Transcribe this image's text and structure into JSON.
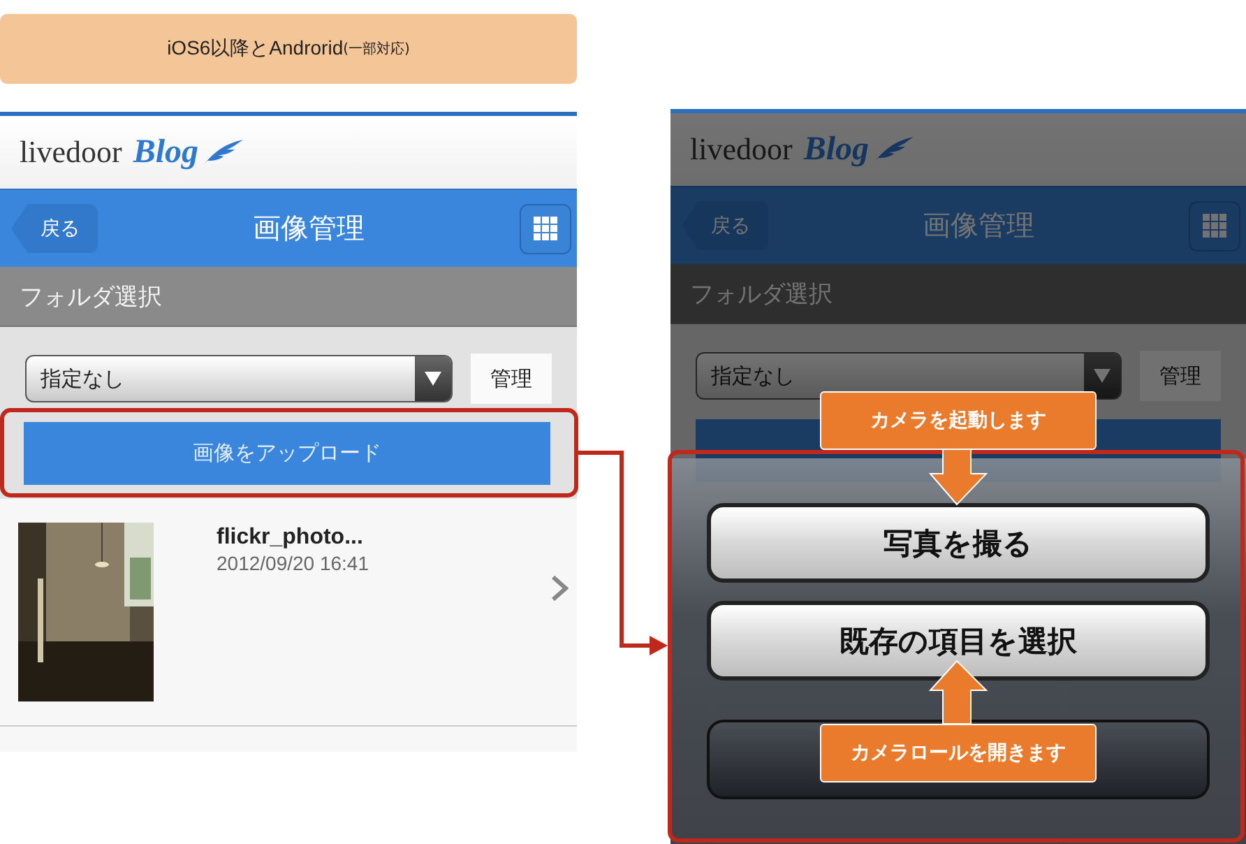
{
  "banner": {
    "text": "iOS6以降とAndrorid",
    "note": "(一部対応)"
  },
  "screens": [
    {
      "kind": "normal",
      "logo": {
        "brand": "livedoor",
        "product": "Blog"
      },
      "nav": {
        "back": "戻る",
        "title": "画像管理"
      },
      "section": "フォルダ選択",
      "folder_select": {
        "value": "指定なし"
      },
      "manage_button": "管理",
      "upload_button": "画像をアップロード",
      "images": [
        {
          "name": "flickr_photo...",
          "date": "2012/09/20 16:41"
        }
      ]
    },
    {
      "kind": "dimmed",
      "logo": {
        "brand": "livedoor",
        "product": "Blog"
      },
      "nav": {
        "back": "戻る",
        "title": "画像管理"
      },
      "section": "フォルダ選択",
      "folder_select": {
        "value": "指定なし"
      },
      "manage_button": "管理",
      "action_sheet": {
        "buttons": [
          {
            "kind": "light",
            "label": "写真を撮る"
          },
          {
            "kind": "light",
            "label": "既存の項目を選択"
          },
          {
            "kind": "dark"
          }
        ]
      }
    }
  ],
  "callouts": [
    {
      "text": "カメラを起動します",
      "kind": "down"
    },
    {
      "text": "カメラロールを開きます",
      "kind": "up"
    }
  ]
}
